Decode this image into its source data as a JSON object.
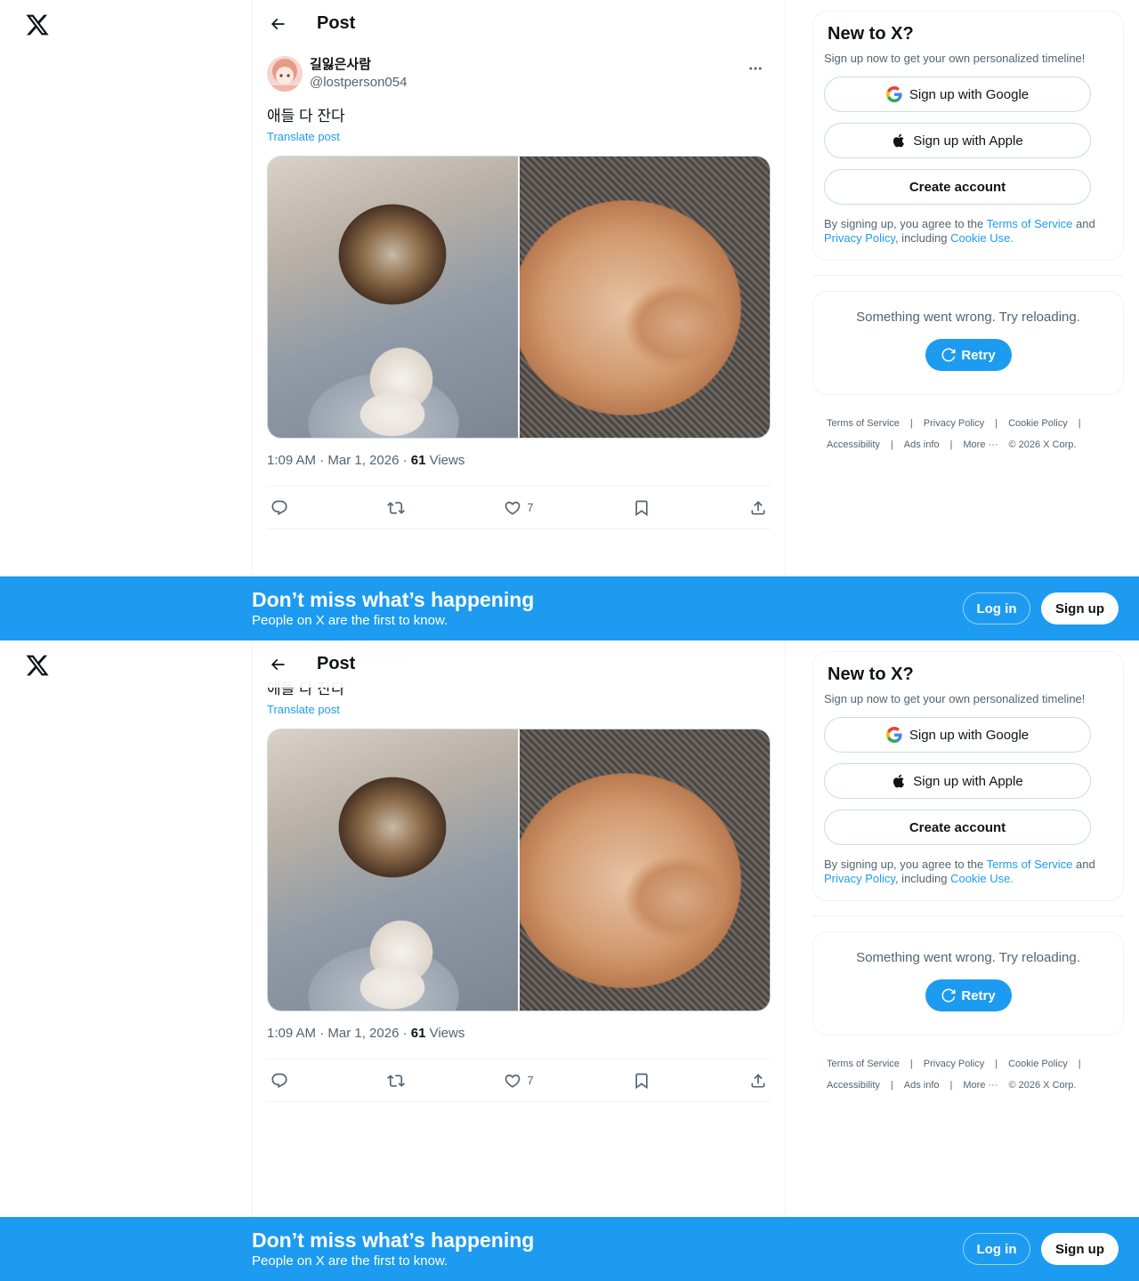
{
  "nav": {
    "logo": "x-logo"
  },
  "header": {
    "title": "Post"
  },
  "post": {
    "display_name": "길잃은사람",
    "handle": "@lostperson054",
    "text": "애들 다 잔다",
    "translate_label": "Translate post",
    "time": "1:09 AM · Mar 1, 2026 · ",
    "views_count": "61",
    "views_label": " Views",
    "likes": "7"
  },
  "signup_card": {
    "title": "New to X?",
    "subtitle": "Sign up now to get your own personalized timeline!",
    "google_label": "Sign up with Google",
    "apple_label": "Sign up with Apple",
    "create_label": "Create account",
    "legal_prefix": "By signing up, you agree to the ",
    "terms_label": "Terms of Service",
    "legal_and": " and ",
    "privacy_label": "Privacy Policy",
    "legal_including": ", including ",
    "cookie_label": "Cookie Use."
  },
  "error_card": {
    "text": "Something went wrong. Try reloading.",
    "retry_label": "Retry"
  },
  "footer": {
    "terms": "Terms of Service",
    "privacy": "Privacy Policy",
    "cookie": "Cookie Policy",
    "accessibility": "Accessibility",
    "ads": "Ads info",
    "more": "More ···",
    "copyright": "© 2026 X Corp.",
    "separator": "|"
  },
  "banner": {
    "title": "Don’t miss what’s happening",
    "subtitle": "People on X are the first to know.",
    "login_label": "Log in",
    "signup_label": "Sign up"
  },
  "colors": {
    "accent": "#1d9bf0",
    "text": "#0f1419",
    "muted": "#536471"
  }
}
